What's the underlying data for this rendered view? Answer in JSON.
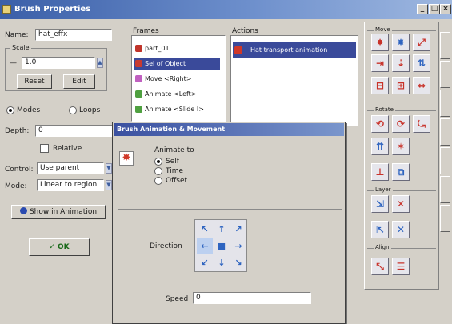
{
  "window": {
    "title": "Brush Properties",
    "controls": [
      "_",
      "□",
      "×"
    ]
  },
  "left": {
    "name_label": "Name:",
    "name_value": "hat_effx",
    "scale_label": "Scale",
    "scale_dash": "—",
    "scale_value": "1.0",
    "btn_reset": "Reset",
    "btn_edit": "Edit",
    "radio_left": "Modes",
    "radio_right": "Loops",
    "depth_label": "Depth:",
    "depth_value": "0",
    "relative_label": "Relative",
    "control_label": "Control:",
    "control_value": "Use parent",
    "mode_label": "Mode:",
    "mode_value": "Linear to region",
    "animate_button": "Show in Animation",
    "ok_button": "✓ OK"
  },
  "frames": {
    "header": "Frames",
    "items": [
      {
        "label": "part_01",
        "color": "#c0342a",
        "selected": false
      },
      {
        "label": "Sel of Object",
        "color": "#c83a30",
        "selected": true
      },
      {
        "label": "Move <Right>",
        "color": "#c060c0",
        "selected": false
      },
      {
        "label": "Animate <Left>",
        "color": "#4fa040",
        "selected": false
      },
      {
        "label": "Animate <Slide I>",
        "color": "#4fa040",
        "selected": false
      }
    ]
  },
  "actions": {
    "header": "Actions",
    "selected_item": "Hat transport animation",
    "selected_icon": "#d03828"
  },
  "dialog": {
    "title": "Brush Animation & Movement",
    "animate_label": "Animate to",
    "options": [
      {
        "label": "Self",
        "on": true
      },
      {
        "label": "Time",
        "on": false
      },
      {
        "label": "Offset",
        "on": false
      }
    ],
    "direction_label": "Direction",
    "speed_label": "Speed",
    "speed_value": "0"
  },
  "tools": {
    "groups": [
      "Move",
      "Rotate",
      "Layer",
      "Align"
    ],
    "icon_color": "#c8322a",
    "icon_color_alt": "#2e64c0"
  }
}
